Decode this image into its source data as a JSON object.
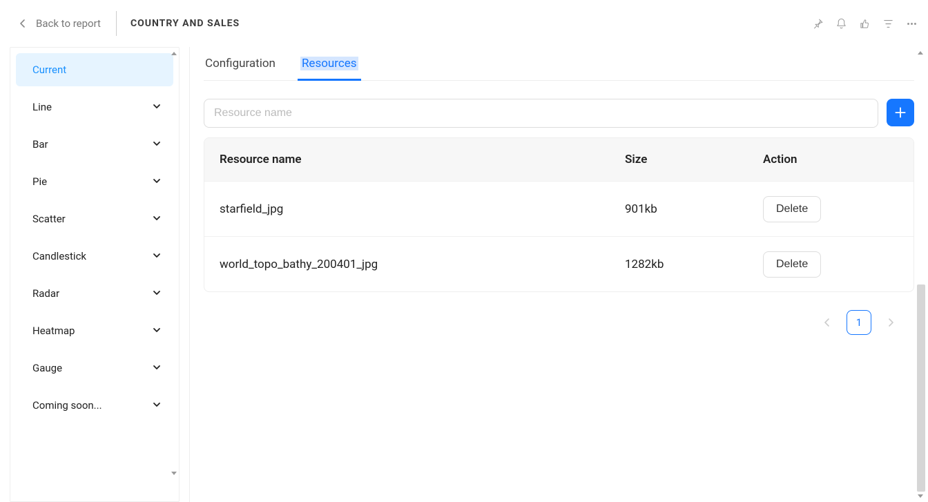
{
  "topbar": {
    "back_label": "Back to report",
    "title": "COUNTRY AND SALES"
  },
  "sidebar": {
    "items": [
      {
        "label": "Current",
        "active": true,
        "expandable": false
      },
      {
        "label": "Line",
        "active": false,
        "expandable": true
      },
      {
        "label": "Bar",
        "active": false,
        "expandable": true
      },
      {
        "label": "Pie",
        "active": false,
        "expandable": true
      },
      {
        "label": "Scatter",
        "active": false,
        "expandable": true
      },
      {
        "label": "Candlestick",
        "active": false,
        "expandable": true
      },
      {
        "label": "Radar",
        "active": false,
        "expandable": true
      },
      {
        "label": "Heatmap",
        "active": false,
        "expandable": true
      },
      {
        "label": "Gauge",
        "active": false,
        "expandable": true
      },
      {
        "label": "Coming soon...",
        "active": false,
        "expandable": true
      }
    ]
  },
  "tabs": {
    "configuration": "Configuration",
    "resources": "Resources"
  },
  "search": {
    "placeholder": "Resource name"
  },
  "table": {
    "headers": {
      "name": "Resource name",
      "size": "Size",
      "action": "Action"
    },
    "delete_label": "Delete",
    "rows": [
      {
        "name": "starfield_jpg",
        "size": "901kb"
      },
      {
        "name": "world_topo_bathy_200401_jpg",
        "size": "1282kb"
      }
    ]
  },
  "pagination": {
    "current": "1"
  }
}
